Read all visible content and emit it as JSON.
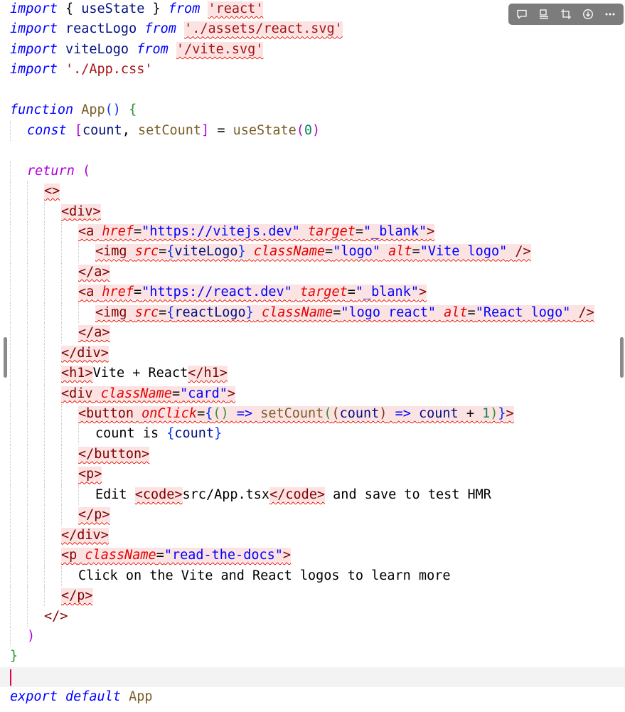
{
  "colors": {
    "keyword": "#0000ff",
    "control": "#af00db",
    "function": "#795e26",
    "variable": "#001080",
    "string": "#a31515",
    "tag": "#800000",
    "attribute": "#e50000",
    "constant": "#0070c1",
    "bracket1": "#0431fa",
    "bracket2": "#319331",
    "bracket3": "#7b3814",
    "plain": "#000000",
    "error_squiggle": "#e51400",
    "cursor": "#e0004a"
  },
  "toolbar": [
    {
      "name": "comment-icon"
    },
    {
      "name": "layout-icon"
    },
    {
      "name": "crop-icon"
    },
    {
      "name": "download-icon"
    },
    {
      "name": "more-icon"
    }
  ],
  "lines": [
    {
      "indent": 0,
      "tokens": [
        {
          "t": "import",
          "c": "#0000ff",
          "i": true
        },
        {
          "t": " { ",
          "c": "#000000"
        },
        {
          "t": "useState",
          "c": "#001080"
        },
        {
          "t": " } ",
          "c": "#000000"
        },
        {
          "t": "from",
          "c": "#0000ff",
          "i": true
        },
        {
          "t": " ",
          "c": "#000000"
        },
        {
          "t": "'react'",
          "c": "#a31515",
          "e": true
        }
      ]
    },
    {
      "indent": 0,
      "tokens": [
        {
          "t": "import",
          "c": "#0000ff",
          "i": true
        },
        {
          "t": " ",
          "c": "#000000"
        },
        {
          "t": "reactLogo",
          "c": "#001080"
        },
        {
          "t": " ",
          "c": "#000000"
        },
        {
          "t": "from",
          "c": "#0000ff",
          "i": true
        },
        {
          "t": " ",
          "c": "#000000"
        },
        {
          "t": "'./assets/react.svg'",
          "c": "#a31515",
          "e": true
        }
      ]
    },
    {
      "indent": 0,
      "tokens": [
        {
          "t": "import",
          "c": "#0000ff",
          "i": true
        },
        {
          "t": " ",
          "c": "#000000"
        },
        {
          "t": "viteLogo",
          "c": "#001080"
        },
        {
          "t": " ",
          "c": "#000000"
        },
        {
          "t": "from",
          "c": "#0000ff",
          "i": true
        },
        {
          "t": " ",
          "c": "#000000"
        },
        {
          "t": "'/vite.svg'",
          "c": "#a31515",
          "e": true
        }
      ]
    },
    {
      "indent": 0,
      "tokens": [
        {
          "t": "import",
          "c": "#0000ff",
          "i": true
        },
        {
          "t": " ",
          "c": "#000000"
        },
        {
          "t": "'./App.css'",
          "c": "#a31515"
        }
      ]
    },
    {
      "indent": 0,
      "tokens": []
    },
    {
      "indent": 0,
      "tokens": [
        {
          "t": "function",
          "c": "#0000ff",
          "i": true
        },
        {
          "t": " ",
          "c": "#000000"
        },
        {
          "t": "App",
          "c": "#795e26"
        },
        {
          "t": "() ",
          "c": "#0431fa"
        },
        {
          "t": "{",
          "c": "#319331"
        }
      ]
    },
    {
      "indent": 1,
      "tokens": [
        {
          "t": "const",
          "c": "#0000ff",
          "i": true
        },
        {
          "t": " ",
          "c": "#000000"
        },
        {
          "t": "[",
          "c": "#af00db"
        },
        {
          "t": "count",
          "c": "#001080"
        },
        {
          "t": ", ",
          "c": "#000000"
        },
        {
          "t": "setCount",
          "c": "#795e26"
        },
        {
          "t": "]",
          "c": "#af00db"
        },
        {
          "t": " = ",
          "c": "#000000"
        },
        {
          "t": "useState",
          "c": "#795e26"
        },
        {
          "t": "(",
          "c": "#af00db"
        },
        {
          "t": "0",
          "c": "#098658"
        },
        {
          "t": ")",
          "c": "#af00db"
        }
      ]
    },
    {
      "indent": 0,
      "tokens": []
    },
    {
      "indent": 1,
      "tokens": [
        {
          "t": "return",
          "c": "#af00db",
          "i": true
        },
        {
          "t": " ",
          "c": "#000000"
        },
        {
          "t": "(",
          "c": "#af00db"
        }
      ]
    },
    {
      "indent": 2,
      "tokens": [
        {
          "t": "<>",
          "c": "#800000",
          "e": true
        }
      ]
    },
    {
      "indent": 3,
      "tokens": [
        {
          "t": "<div>",
          "c": "#800000",
          "e": true
        }
      ]
    },
    {
      "indent": 4,
      "tokens": [
        {
          "t": "<a",
          "c": "#800000",
          "e": true
        },
        {
          "t": " ",
          "c": "#000000",
          "e": true
        },
        {
          "t": "href",
          "c": "#e50000",
          "i": true,
          "e": true
        },
        {
          "t": "=",
          "c": "#000000",
          "e": true
        },
        {
          "t": "\"https://vitejs.dev\"",
          "c": "#0000ff",
          "e": true
        },
        {
          "t": " ",
          "c": "#000000",
          "e": true
        },
        {
          "t": "target",
          "c": "#e50000",
          "i": true,
          "e": true
        },
        {
          "t": "=",
          "c": "#000000",
          "e": true
        },
        {
          "t": "\"_blank\"",
          "c": "#0000ff",
          "e": true
        },
        {
          "t": ">",
          "c": "#800000",
          "e": true
        }
      ]
    },
    {
      "indent": 5,
      "tokens": [
        {
          "t": "<img",
          "c": "#800000",
          "e": true
        },
        {
          "t": " ",
          "c": "#000000",
          "e": true
        },
        {
          "t": "src",
          "c": "#e50000",
          "i": true,
          "e": true
        },
        {
          "t": "=",
          "c": "#000000",
          "e": true
        },
        {
          "t": "{",
          "c": "#0431fa",
          "e": true
        },
        {
          "t": "viteLogo",
          "c": "#001080",
          "e": true
        },
        {
          "t": "}",
          "c": "#0431fa",
          "e": true
        },
        {
          "t": " ",
          "c": "#000000",
          "e": true
        },
        {
          "t": "className",
          "c": "#e50000",
          "i": true,
          "e": true
        },
        {
          "t": "=",
          "c": "#000000",
          "e": true
        },
        {
          "t": "\"logo\"",
          "c": "#0000ff",
          "e": true
        },
        {
          "t": " ",
          "c": "#000000",
          "e": true
        },
        {
          "t": "alt",
          "c": "#e50000",
          "i": true,
          "e": true
        },
        {
          "t": "=",
          "c": "#000000",
          "e": true
        },
        {
          "t": "\"Vite logo\"",
          "c": "#0000ff",
          "e": true
        },
        {
          "t": " ",
          "c": "#000000",
          "e": true
        },
        {
          "t": "/>",
          "c": "#800000",
          "e": true
        }
      ]
    },
    {
      "indent": 4,
      "tokens": [
        {
          "t": "</a>",
          "c": "#800000",
          "e": true
        }
      ]
    },
    {
      "indent": 4,
      "tokens": [
        {
          "t": "<a",
          "c": "#800000",
          "e": true
        },
        {
          "t": " ",
          "c": "#000000",
          "e": true
        },
        {
          "t": "href",
          "c": "#e50000",
          "i": true,
          "e": true
        },
        {
          "t": "=",
          "c": "#000000",
          "e": true
        },
        {
          "t": "\"https://react.dev\"",
          "c": "#0000ff",
          "e": true
        },
        {
          "t": " ",
          "c": "#000000",
          "e": true
        },
        {
          "t": "target",
          "c": "#e50000",
          "i": true,
          "e": true
        },
        {
          "t": "=",
          "c": "#000000",
          "e": true
        },
        {
          "t": "\"_blank\"",
          "c": "#0000ff",
          "e": true
        },
        {
          "t": ">",
          "c": "#800000",
          "e": true
        }
      ]
    },
    {
      "indent": 5,
      "tokens": [
        {
          "t": "<img",
          "c": "#800000",
          "e": true
        },
        {
          "t": " ",
          "c": "#000000",
          "e": true
        },
        {
          "t": "src",
          "c": "#e50000",
          "i": true,
          "e": true
        },
        {
          "t": "=",
          "c": "#000000",
          "e": true
        },
        {
          "t": "{",
          "c": "#0431fa",
          "e": true
        },
        {
          "t": "reactLogo",
          "c": "#001080",
          "e": true
        },
        {
          "t": "}",
          "c": "#0431fa",
          "e": true
        },
        {
          "t": " ",
          "c": "#000000",
          "e": true
        },
        {
          "t": "className",
          "c": "#e50000",
          "i": true,
          "e": true
        },
        {
          "t": "=",
          "c": "#000000",
          "e": true
        },
        {
          "t": "\"logo react\"",
          "c": "#0000ff",
          "e": true
        },
        {
          "t": " ",
          "c": "#000000",
          "e": true
        },
        {
          "t": "alt",
          "c": "#e50000",
          "i": true,
          "e": true
        },
        {
          "t": "=",
          "c": "#000000",
          "e": true
        },
        {
          "t": "\"React logo\"",
          "c": "#0000ff",
          "e": true
        },
        {
          "t": " ",
          "c": "#000000",
          "e": true
        },
        {
          "t": "/>",
          "c": "#800000",
          "e": true
        }
      ]
    },
    {
      "indent": 4,
      "tokens": [
        {
          "t": "</a>",
          "c": "#800000",
          "e": true
        }
      ]
    },
    {
      "indent": 3,
      "tokens": [
        {
          "t": "</div>",
          "c": "#800000",
          "e": true
        }
      ]
    },
    {
      "indent": 3,
      "tokens": [
        {
          "t": "<h1>",
          "c": "#800000",
          "e": true
        },
        {
          "t": "Vite + React",
          "c": "#000000"
        },
        {
          "t": "</h1>",
          "c": "#800000",
          "e": true
        }
      ]
    },
    {
      "indent": 3,
      "tokens": [
        {
          "t": "<div",
          "c": "#800000",
          "e": true
        },
        {
          "t": " ",
          "c": "#000000",
          "e": true
        },
        {
          "t": "className",
          "c": "#e50000",
          "i": true,
          "e": true
        },
        {
          "t": "=",
          "c": "#000000",
          "e": true
        },
        {
          "t": "\"card\"",
          "c": "#0000ff",
          "e": true
        },
        {
          "t": ">",
          "c": "#800000",
          "e": true
        }
      ]
    },
    {
      "indent": 4,
      "tokens": [
        {
          "t": "<button",
          "c": "#800000",
          "e": true
        },
        {
          "t": " ",
          "c": "#000000",
          "e": true
        },
        {
          "t": "onClick",
          "c": "#e50000",
          "i": true,
          "e": true
        },
        {
          "t": "=",
          "c": "#000000",
          "e": true
        },
        {
          "t": "{",
          "c": "#0431fa",
          "e": true
        },
        {
          "t": "() ",
          "c": "#319331",
          "e": true
        },
        {
          "t": "=>",
          "c": "#0000ff",
          "e": true
        },
        {
          "t": " ",
          "c": "#000000",
          "e": true
        },
        {
          "t": "setCount",
          "c": "#795e26",
          "e": true
        },
        {
          "t": "(",
          "c": "#319331",
          "e": true
        },
        {
          "t": "(",
          "c": "#7b3814",
          "e": true
        },
        {
          "t": "count",
          "c": "#001080",
          "e": true
        },
        {
          "t": ")",
          "c": "#7b3814",
          "e": true
        },
        {
          "t": " ",
          "c": "#000000",
          "e": true
        },
        {
          "t": "=>",
          "c": "#0000ff",
          "e": true
        },
        {
          "t": " ",
          "c": "#000000",
          "e": true
        },
        {
          "t": "count",
          "c": "#001080",
          "e": true
        },
        {
          "t": " + ",
          "c": "#000000",
          "e": true
        },
        {
          "t": "1",
          "c": "#098658",
          "e": true
        },
        {
          "t": ")",
          "c": "#319331",
          "e": true
        },
        {
          "t": "}",
          "c": "#0431fa",
          "e": true
        },
        {
          "t": ">",
          "c": "#800000",
          "e": true
        }
      ]
    },
    {
      "indent": 5,
      "tokens": [
        {
          "t": "count is ",
          "c": "#000000"
        },
        {
          "t": "{",
          "c": "#0431fa"
        },
        {
          "t": "count",
          "c": "#001080"
        },
        {
          "t": "}",
          "c": "#0431fa"
        }
      ]
    },
    {
      "indent": 4,
      "tokens": [
        {
          "t": "</button>",
          "c": "#800000",
          "e": true
        }
      ]
    },
    {
      "indent": 4,
      "tokens": [
        {
          "t": "<p>",
          "c": "#800000",
          "e": true
        }
      ]
    },
    {
      "indent": 5,
      "tokens": [
        {
          "t": "Edit ",
          "c": "#000000"
        },
        {
          "t": "<code>",
          "c": "#800000",
          "e": true
        },
        {
          "t": "src/App.tsx",
          "c": "#000000"
        },
        {
          "t": "</code>",
          "c": "#800000",
          "e": true
        },
        {
          "t": " and save to test HMR",
          "c": "#000000"
        }
      ]
    },
    {
      "indent": 4,
      "tokens": [
        {
          "t": "</p>",
          "c": "#800000",
          "e": true
        }
      ]
    },
    {
      "indent": 3,
      "tokens": [
        {
          "t": "</div>",
          "c": "#800000",
          "e": true
        }
      ]
    },
    {
      "indent": 3,
      "tokens": [
        {
          "t": "<p",
          "c": "#800000",
          "e": true
        },
        {
          "t": " ",
          "c": "#000000",
          "e": true
        },
        {
          "t": "className",
          "c": "#e50000",
          "i": true,
          "e": true
        },
        {
          "t": "=",
          "c": "#000000",
          "e": true
        },
        {
          "t": "\"read-the-docs\"",
          "c": "#0000ff",
          "e": true
        },
        {
          "t": ">",
          "c": "#800000",
          "e": true
        }
      ]
    },
    {
      "indent": 4,
      "tokens": [
        {
          "t": "Click on the Vite and React logos to learn more",
          "c": "#000000"
        }
      ]
    },
    {
      "indent": 3,
      "tokens": [
        {
          "t": "</p>",
          "c": "#800000",
          "e": true
        }
      ]
    },
    {
      "indent": 2,
      "tokens": [
        {
          "t": "</>",
          "c": "#800000"
        }
      ]
    },
    {
      "indent": 1,
      "tokens": [
        {
          "t": ")",
          "c": "#af00db"
        }
      ]
    },
    {
      "indent": 0,
      "tokens": [
        {
          "t": "}",
          "c": "#319331"
        }
      ]
    },
    {
      "indent": 0,
      "current": true,
      "tokens": []
    },
    {
      "indent": 0,
      "tokens": [
        {
          "t": "export",
          "c": "#0000ff",
          "i": true
        },
        {
          "t": " ",
          "c": "#000000"
        },
        {
          "t": "default",
          "c": "#0000ff",
          "i": true
        },
        {
          "t": " ",
          "c": "#000000"
        },
        {
          "t": "App",
          "c": "#795e26"
        }
      ]
    }
  ]
}
